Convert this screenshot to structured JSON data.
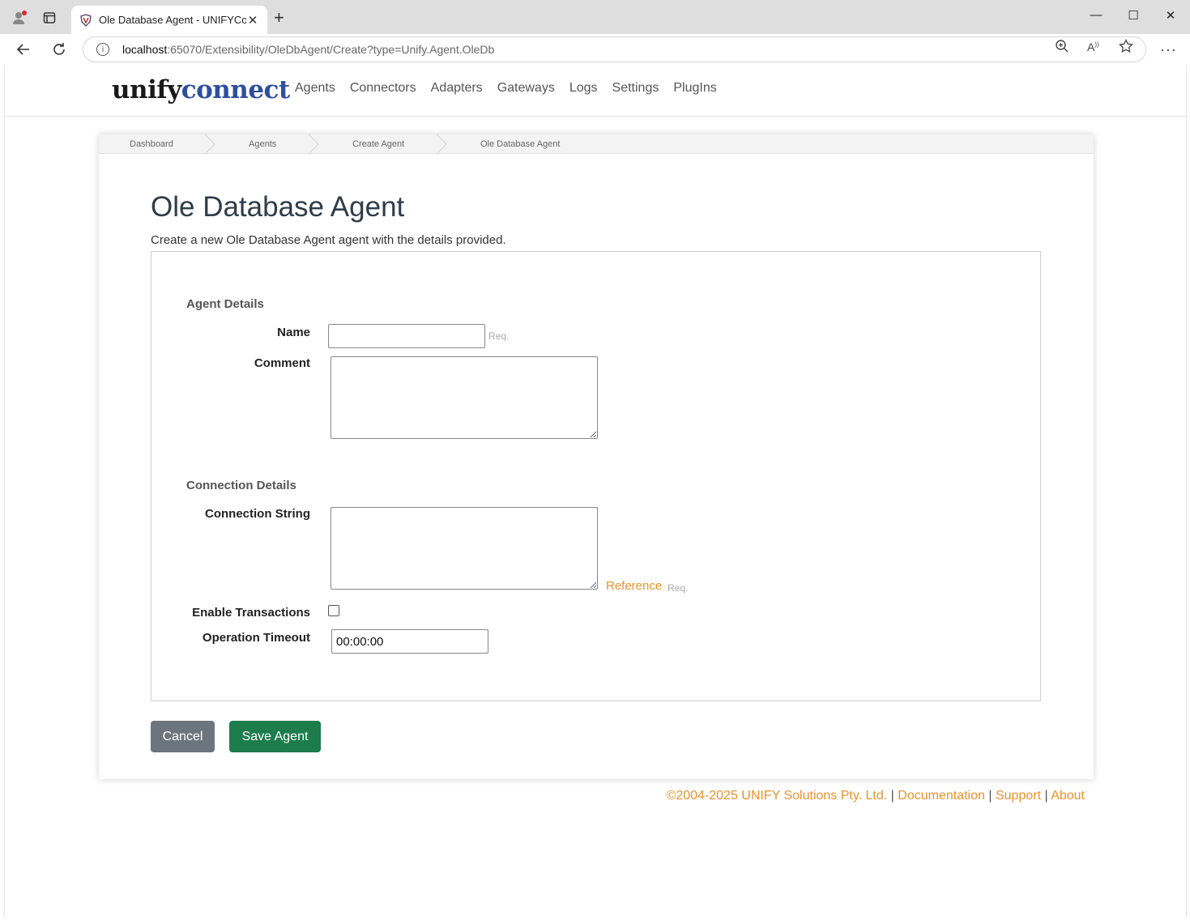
{
  "browser": {
    "tab_title": "Ole Database Agent - UNIFYConn",
    "url_host": "localhost",
    "url_path": ":65070/Extensibility/OleDbAgent/Create?type=Unify.Agent.OleDb"
  },
  "header": {
    "logo_part1": "unify",
    "logo_part2": "connect",
    "nav": [
      "Agents",
      "Connectors",
      "Adapters",
      "Gateways",
      "Logs",
      "Settings",
      "PlugIns"
    ]
  },
  "breadcrumb": [
    "Dashboard",
    "Agents",
    "Create Agent",
    "Ole Database Agent"
  ],
  "main": {
    "title": "Ole Database Agent",
    "lead": "Create a new Ole Database Agent agent with the details provided."
  },
  "form": {
    "agent_section": "Agent Details",
    "name_label": "Name",
    "name_value": "",
    "required_hint": "Req.",
    "comment_label": "Comment",
    "connection_section": "Connection Details",
    "connection_string_label": "Connection String",
    "reference_link": "Reference",
    "enable_transactions_label": "Enable Transactions",
    "enable_transactions_checked": false,
    "operation_timeout_label": "Operation Timeout",
    "operation_timeout_value": "00:00:00"
  },
  "actions": {
    "cancel_label": "Cancel",
    "save_label": "Save Agent"
  },
  "footer": {
    "copyright": "©2004-2025 UNIFY Solutions Pty. Ltd.",
    "separator": "|",
    "links": [
      "Documentation",
      "Support",
      "About"
    ]
  },
  "colors": {
    "accent_orange": "#e8922e",
    "save_green": "#1c7c4c",
    "cancel_gray": "#6c757d",
    "logo_blue": "#2f4f9e"
  }
}
